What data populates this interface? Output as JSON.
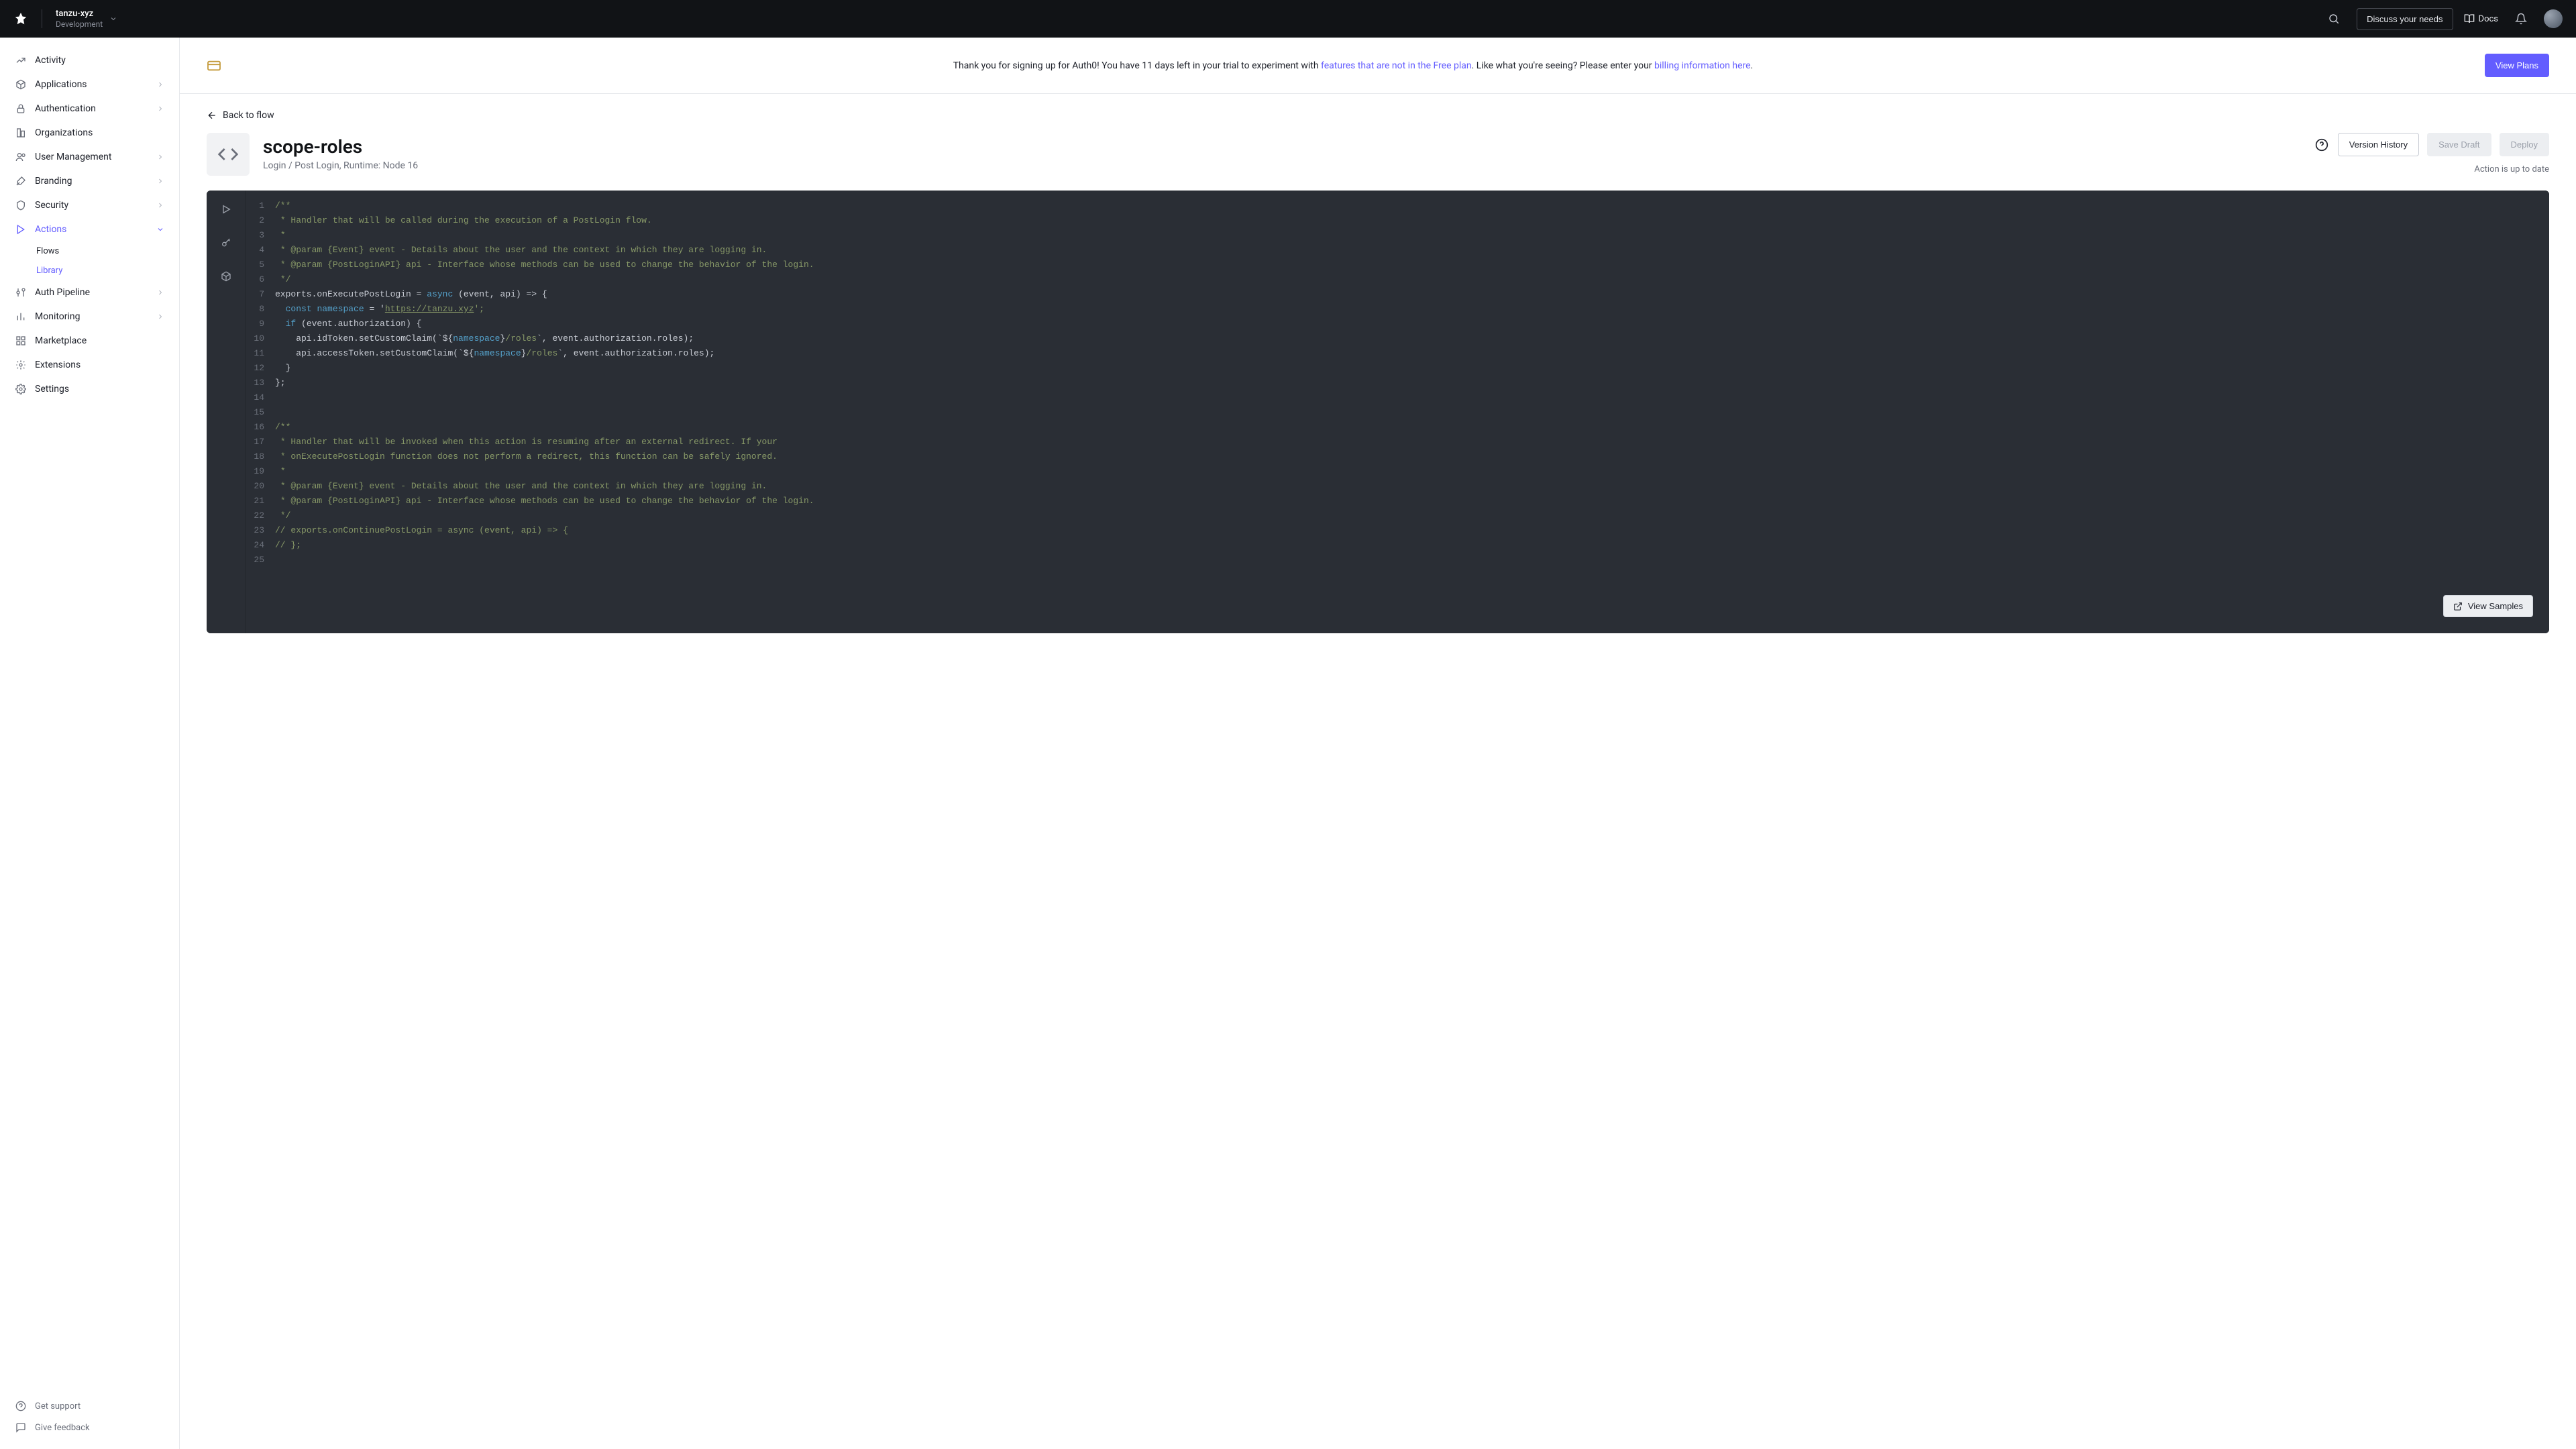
{
  "header": {
    "tenant_name": "tanzu-xyz",
    "tenant_env": "Development",
    "discuss_label": "Discuss your needs",
    "docs_label": "Docs"
  },
  "sidebar": {
    "items": [
      {
        "label": "Activity",
        "icon": "activity",
        "expandable": false
      },
      {
        "label": "Applications",
        "icon": "applications",
        "expandable": true
      },
      {
        "label": "Authentication",
        "icon": "authentication",
        "expandable": true
      },
      {
        "label": "Organizations",
        "icon": "organizations",
        "expandable": false
      },
      {
        "label": "User Management",
        "icon": "user-management",
        "expandable": true
      },
      {
        "label": "Branding",
        "icon": "branding",
        "expandable": true
      },
      {
        "label": "Security",
        "icon": "security",
        "expandable": true
      },
      {
        "label": "Actions",
        "icon": "actions",
        "expandable": true,
        "active": true
      },
      {
        "label": "Auth Pipeline",
        "icon": "auth-pipeline",
        "expandable": true
      },
      {
        "label": "Monitoring",
        "icon": "monitoring",
        "expandable": true
      },
      {
        "label": "Marketplace",
        "icon": "marketplace",
        "expandable": false
      },
      {
        "label": "Extensions",
        "icon": "extensions",
        "expandable": false
      },
      {
        "label": "Settings",
        "icon": "settings",
        "expandable": false
      }
    ],
    "actions_sub": [
      {
        "label": "Flows",
        "active": false
      },
      {
        "label": "Library",
        "active": true
      }
    ],
    "bottom": {
      "support": "Get support",
      "feedback": "Give feedback"
    }
  },
  "banner": {
    "prefix": "Thank you for signing up for Auth0! You have 11 days left in your trial to experiment with ",
    "link1": "features that are not in the Free plan",
    "middle": ". Like what you're seeing? Please enter your ",
    "link2": "billing information here",
    "suffix": ".",
    "cta": "View Plans"
  },
  "page": {
    "back_label": "Back to flow",
    "title": "scope-roles",
    "subtitle": "Login / Post Login, Runtime: Node 16",
    "version_history": "Version History",
    "save_draft": "Save Draft",
    "deploy": "Deploy",
    "status": "Action is up to date",
    "view_samples": "View Samples"
  },
  "code": {
    "lines": 25,
    "l1": "/**",
    "l2": "* Handler that will be called during the execution of a PostLogin flow.",
    "l3": "*",
    "l4": "* @param {Event} event - Details about the user and the context in which they are logging in.",
    "l5": "* @param {PostLoginAPI} api - Interface whose methods can be used to change the behavior of the login.",
    "l6": "*/",
    "l7a": "exports.onExecutePostLogin = ",
    "l7b": "async",
    "l7c": " (event, api) => {",
    "l8a": "  ",
    "l8b": "const",
    "l8c": " ",
    "l8d": "namespace",
    "l8e": " = '",
    "l8f": "https://tanzu.xyz",
    "l8g": "';",
    "l9a": "  ",
    "l9b": "if",
    "l9c": " (event.authorization) {",
    "l10a": "    api.idToken.setCustomClaim(`${",
    "l10b": "namespace",
    "l10c": "}",
    "l10d": "/roles",
    "l10e": "`, event.authorization.roles);",
    "l11a": "    api.accessToken.setCustomClaim(`${",
    "l11b": "namespace",
    "l11c": "}",
    "l11d": "/roles",
    "l11e": "`, event.authorization.roles);",
    "l12": "  }",
    "l13": "};",
    "l16": "/**",
    "l17": "* Handler that will be invoked when this action is resuming after an external redirect. If your",
    "l18": "* onExecutePostLogin function does not perform a redirect, this function can be safely ignored.",
    "l19": "*",
    "l20": "* @param {Event} event - Details about the user and the context in which they are logging in.",
    "l21": "* @param {PostLoginAPI} api - Interface whose methods can be used to change the behavior of the login.",
    "l22": "*/",
    "l23": "// exports.onContinuePostLogin = async (event, api) => {",
    "l24": "// };"
  }
}
